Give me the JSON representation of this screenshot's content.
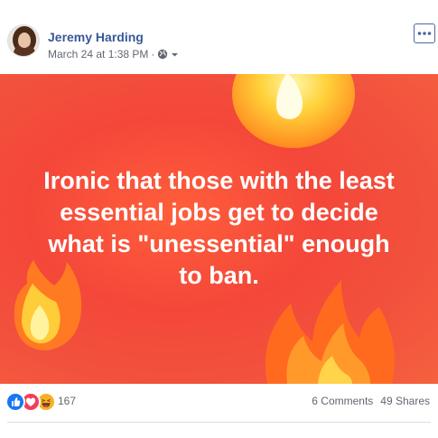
{
  "post": {
    "author": "Jeremy Harding",
    "timestamp": "March 24 at 1:38 PM",
    "separator": "·",
    "privacy_icon": "globe-icon",
    "audience_icon": "caret-down-icon",
    "more_icon": "ellipsis-icon"
  },
  "banner": {
    "lines": [
      "Ironic that those with the least",
      "essential jobs get to decide",
      "what is \"unessential\" enough",
      "to ban."
    ],
    "background_color": "#f44a3a",
    "text_color": "#ffffff"
  },
  "footer": {
    "reaction_icons": [
      "like-icon",
      "love-icon",
      "haha-icon"
    ],
    "reaction_count": "167",
    "comments": "6 Comments",
    "shares": "49 Shares"
  },
  "colors": {
    "name": "#385898",
    "meta": "#616770",
    "like": "#1877f2",
    "love": "#f33e58",
    "haha": "#f7b125"
  }
}
